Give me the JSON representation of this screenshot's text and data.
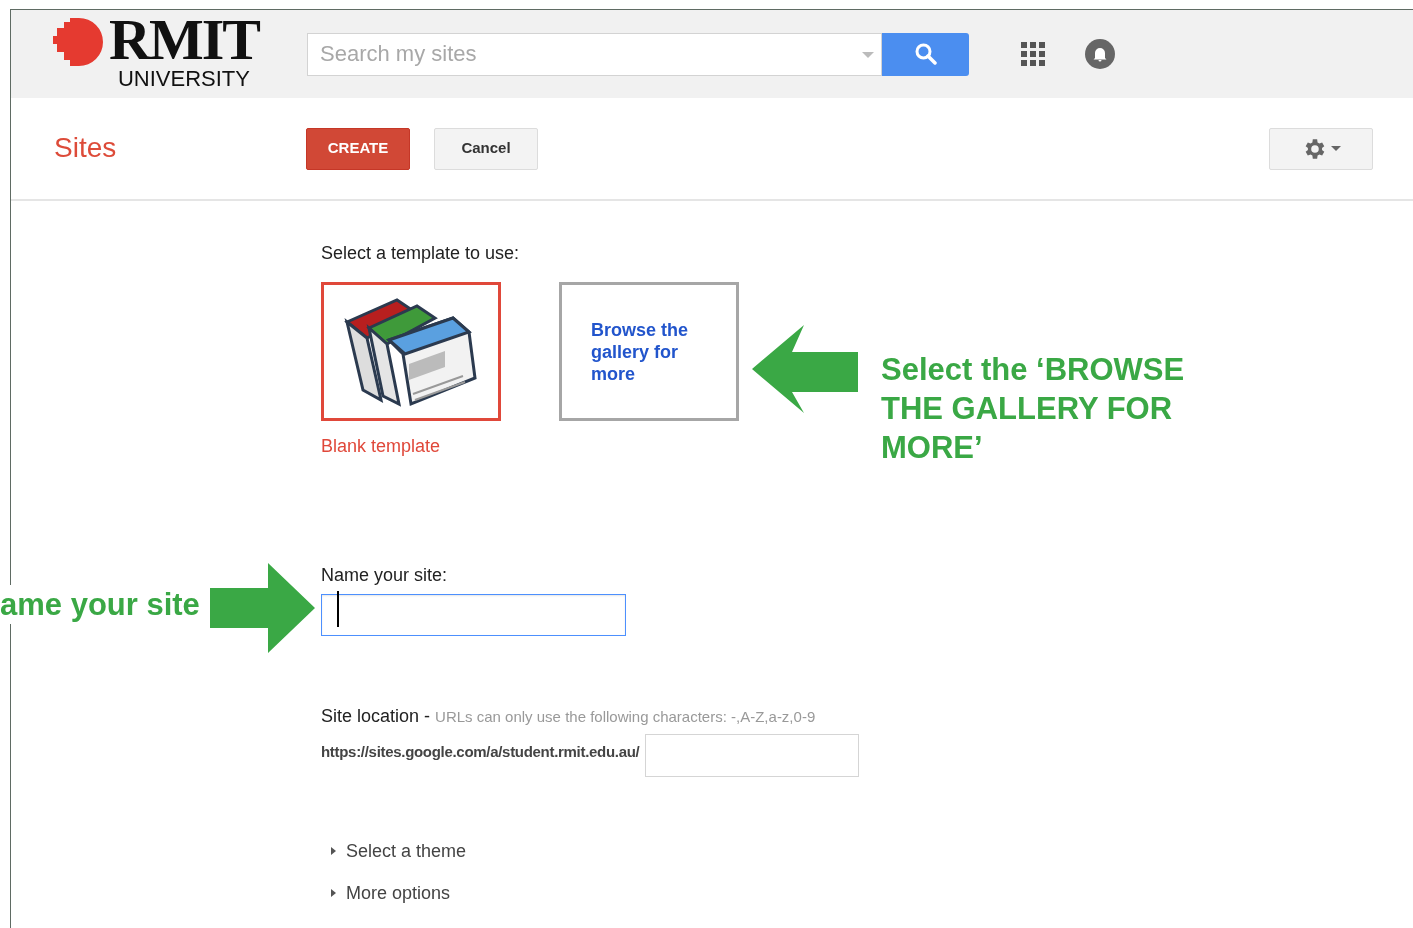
{
  "header": {
    "logo": {
      "name": "RMIT",
      "subtitle": "UNIVERSITY"
    },
    "search": {
      "placeholder": "Search my sites"
    }
  },
  "toolbar": {
    "title": "Sites",
    "buttons": [
      {
        "label": "CREATE",
        "kind": "primary"
      },
      {
        "label": "Cancel",
        "kind": "secondary"
      }
    ]
  },
  "template_section": {
    "label": "Select a template to use:",
    "templates": [
      {
        "kind": "blank",
        "label": "Blank template",
        "selected": true
      },
      {
        "kind": "gallery",
        "label": "Browse the gallery for more",
        "selected": false
      }
    ]
  },
  "name_section": {
    "label": "Name your site:",
    "focused": true
  },
  "location_section": {
    "label": "Site location",
    "hint": "URLs can only use the following characters: -,A-Z,a-z,0-9",
    "separator": "-",
    "prefix": "https://sites.google.com/a/student.rmit.edu.au/"
  },
  "expanders": [
    {
      "label": "Select a theme",
      "expanded": false
    },
    {
      "label": "More options",
      "expanded": false
    }
  ],
  "annotations": [
    {
      "kind": "arrow-left",
      "text": "Select the ‘BROWSE THE GALLERY FOR MORE’"
    },
    {
      "kind": "arrow-right",
      "text": "ame your site"
    }
  ]
}
